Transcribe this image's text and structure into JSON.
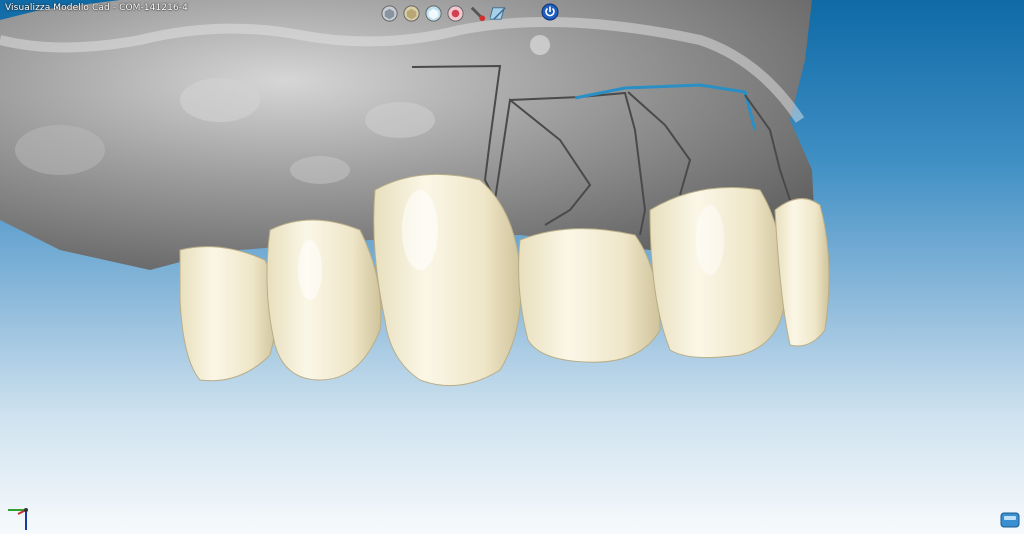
{
  "window": {
    "title": "Visualizza Modello Cad  - COM-141216-4"
  },
  "toolbar": {
    "buttons": [
      {
        "icon": "view-tooth-icon",
        "label": "Tooth view"
      },
      {
        "icon": "view-crown-icon",
        "label": "Crown view"
      },
      {
        "icon": "view-transparent-icon",
        "label": "Transparent view"
      },
      {
        "icon": "view-section-icon",
        "label": "Section view"
      },
      {
        "icon": "measure-tool-icon",
        "label": "Measure"
      },
      {
        "icon": "cut-plane-icon",
        "label": "Cut plane"
      }
    ],
    "power_icon": "power-icon"
  },
  "viewport": {
    "colors": {
      "background_top": "#0f6aa6",
      "background_bottom": "#f7fafc",
      "gum_model": "#9a9a9a",
      "tooth": "#efe8cf",
      "margin_line": "#4a4a4a",
      "margin_line_selected": "#2a8fc4"
    }
  },
  "axis_gizmo": {
    "icon": "axis-triad-icon"
  },
  "corner_button": {
    "icon": "layers-icon"
  }
}
